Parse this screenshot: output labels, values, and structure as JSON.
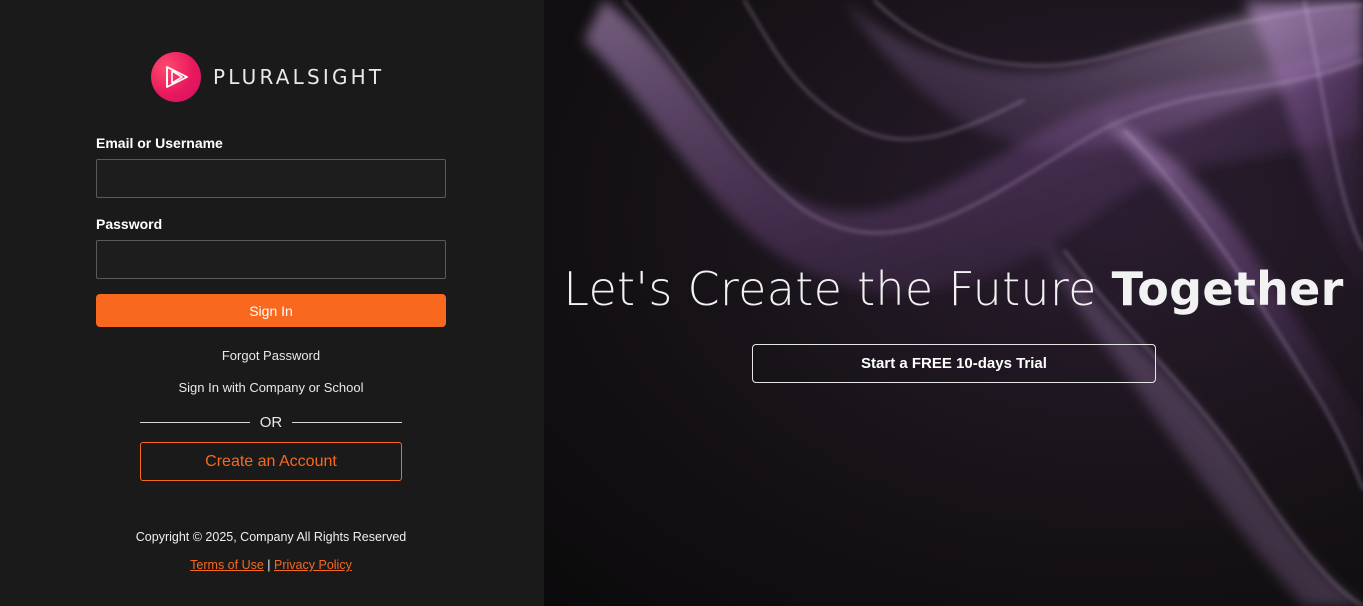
{
  "brand": {
    "name": "PLURALSIGHT",
    "logo_gradient": [
      "#ff4a6e",
      "#e8195c",
      "#d10f6d"
    ]
  },
  "login": {
    "email_label": "Email or Username",
    "email_value": "",
    "email_placeholder": "",
    "password_label": "Password",
    "password_value": "",
    "password_placeholder": "",
    "signin_label": "Sign In",
    "forgot_label": "Forgot Password",
    "company_signin_label": "Sign In with Company or School",
    "or_label": "OR",
    "create_account_label": "Create an Account"
  },
  "footer": {
    "copyright": "Copyright © 2025, Company All Rights Reserved",
    "terms_label": "Terms of Use",
    "separator": "|",
    "privacy_label": "Privacy Policy"
  },
  "hero": {
    "headline_regular": "Let's Create the Future ",
    "headline_bold": "Together",
    "trial_label": "Start a FREE 10-days Trial"
  },
  "colors": {
    "accent": "#f8691f",
    "panel_bg": "#1a1a1a",
    "smoke": "#9b6bb3"
  }
}
